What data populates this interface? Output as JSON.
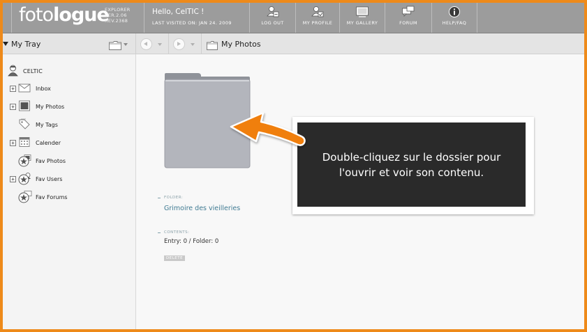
{
  "logo": {
    "light": "foto",
    "bold": "logue",
    "edition": "EXPLORER",
    "version": "VER.2.06",
    "revision": "REV.2368"
  },
  "header": {
    "greeting": "Hello, CelTIC !",
    "last_visited": "LAST VISITED ON: JAN 24. 2009"
  },
  "nav": [
    {
      "label": "LOG OUT",
      "icon": "logout-icon"
    },
    {
      "label": "MY PROFILE",
      "icon": "profile-icon"
    },
    {
      "label": "MY GALLERY",
      "icon": "gallery-icon"
    },
    {
      "label": "FORUM",
      "icon": "forum-icon"
    },
    {
      "label": "HELP/FAQ",
      "icon": "info-icon"
    }
  ],
  "toolbar": {
    "tray_label": "My Tray",
    "path_label": "My Photos"
  },
  "sidebar": {
    "user": "CELTIC",
    "items": [
      {
        "label": "Inbox",
        "expandable": true,
        "icon": "mail-icon"
      },
      {
        "label": "My Photos",
        "expandable": true,
        "icon": "photo-icon"
      },
      {
        "label": "My Tags",
        "expandable": false,
        "icon": "tag-icon"
      },
      {
        "label": "Calender",
        "expandable": true,
        "icon": "calendar-icon"
      },
      {
        "label": "Fav Photos",
        "expandable": false,
        "icon": "fav-photos-icon"
      },
      {
        "label": "Fav Users",
        "expandable": true,
        "icon": "fav-users-icon"
      },
      {
        "label": "Fav Forums",
        "expandable": false,
        "icon": "fav-forums-icon"
      }
    ]
  },
  "main": {
    "folder_label": "FOLDER:",
    "folder_name": "Grimoire des vieilleries",
    "contents_label": "CONTENTS:",
    "contents_value": "Entry: 0 / Folder: 0",
    "delete_label": "DELETE"
  },
  "callout": {
    "text": "Double-cliquez sur le dossier pour l'ouvrir et voir son contenu."
  },
  "colors": {
    "frame": "#ee8a1a",
    "topbar": "#9c9c9c",
    "link": "#3f7a92",
    "callout_bg": "#2a2a2a",
    "arrow": "#f07f0c"
  }
}
